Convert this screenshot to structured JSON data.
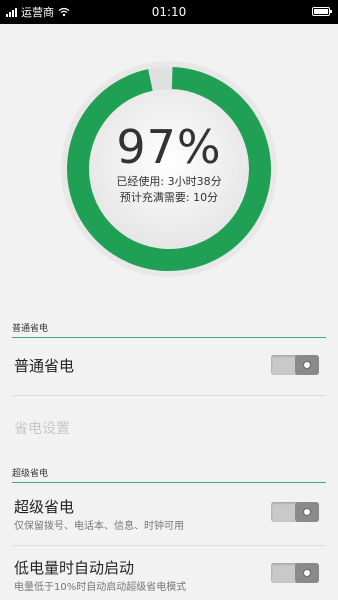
{
  "status_bar": {
    "carrier": "运营商",
    "time": "01:10",
    "battery_level": 0.97
  },
  "battery": {
    "percent_text": "97%",
    "percent_value": 97,
    "used_label": "已经使用:",
    "used_value": "3小时38分",
    "full_charge_label": "预计充满需要:",
    "full_charge_value": "10分",
    "ring_color": "#1fa055",
    "ring_track_color": "#e0e0e0"
  },
  "normal_section": {
    "header": "普通省电",
    "toggle_label": "普通省电",
    "toggle_on": false,
    "settings_label": "省电设置"
  },
  "super_section": {
    "header": "超级省电",
    "super_title": "超级省电",
    "super_desc": "仅保留拨号、电话本、信息、时钟可用",
    "super_on": false,
    "auto_title": "低电量时自动启动",
    "auto_desc": "电量低于10%时自动启动超级省电模式",
    "auto_on": false
  }
}
